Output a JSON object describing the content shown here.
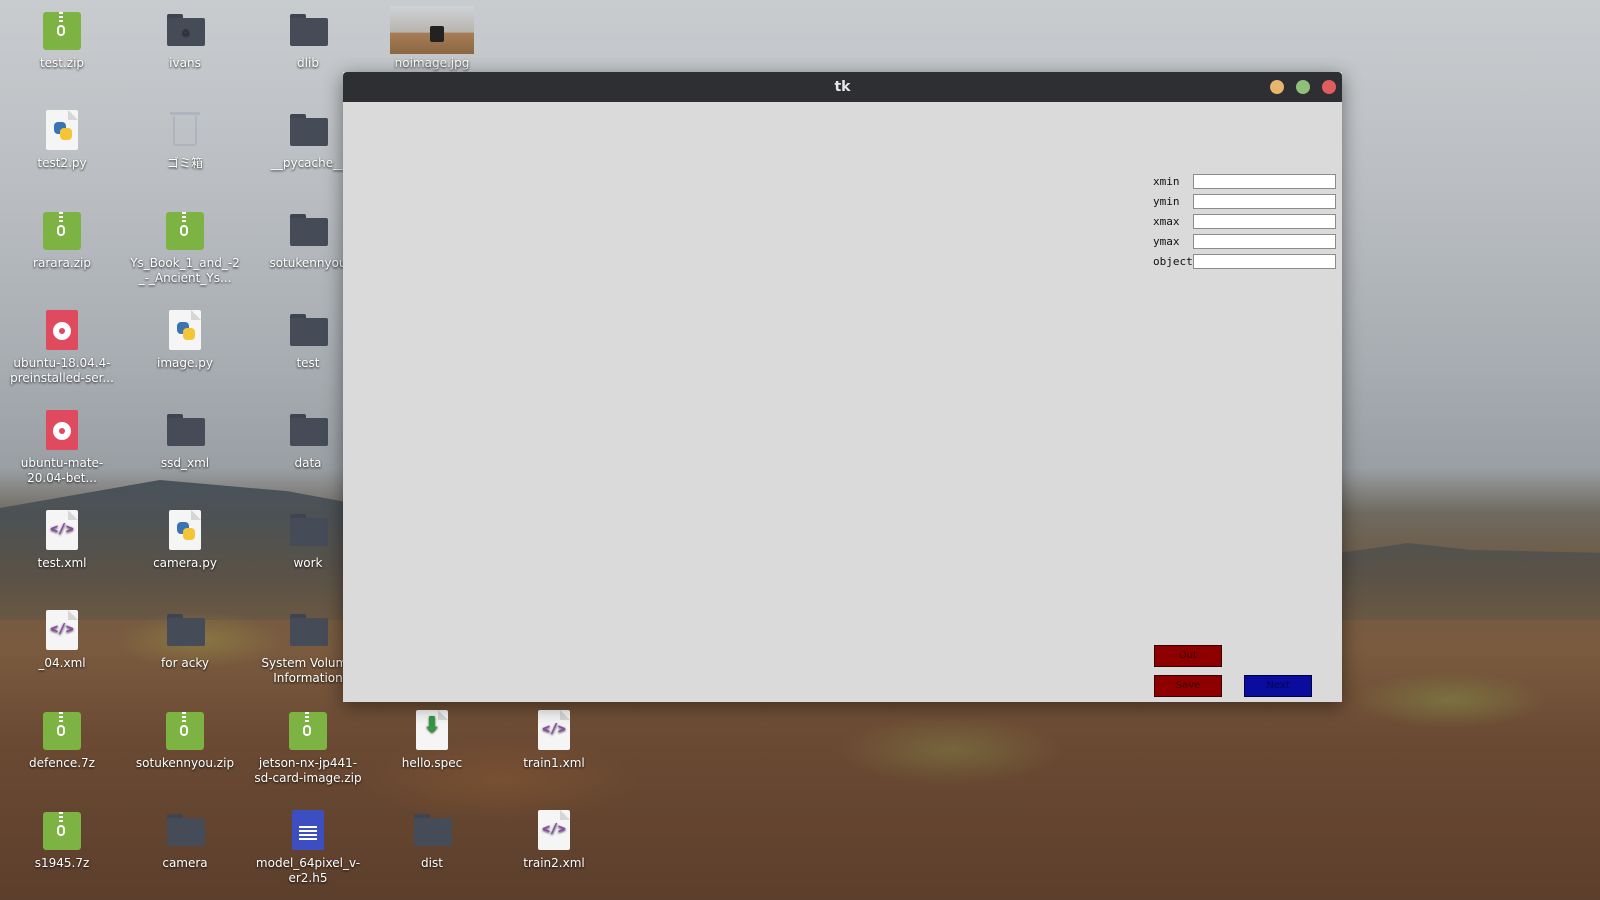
{
  "desktop": {
    "icons": [
      {
        "label": "test.zip",
        "type": "zip"
      },
      {
        "label": "ivans",
        "type": "folder-home"
      },
      {
        "label": "dlib",
        "type": "folder"
      },
      {
        "label": "noimage.jpg",
        "type": "image"
      },
      {
        "label": "test2.py",
        "type": "python"
      },
      {
        "label": "ゴミ箱",
        "type": "trash"
      },
      {
        "label": "__pycache__",
        "type": "folder"
      },
      {
        "label": "rarara.zip",
        "type": "zip"
      },
      {
        "label": "Ys_Book_1_and_-2_-_Ancient_Ys...",
        "type": "zip"
      },
      {
        "label": "sotukennyou",
        "type": "folder"
      },
      {
        "label": "ubuntu-18.04.4-preinstalled-ser...",
        "type": "disc"
      },
      {
        "label": "image.py",
        "type": "python"
      },
      {
        "label": "test",
        "type": "folder"
      },
      {
        "label": "ubuntu-mate-20.04-bet...",
        "type": "disc"
      },
      {
        "label": "ssd_xml",
        "type": "folder"
      },
      {
        "label": "data",
        "type": "folder"
      },
      {
        "label": "test.xml",
        "type": "xml"
      },
      {
        "label": "camera.py",
        "type": "python"
      },
      {
        "label": "work",
        "type": "folder"
      },
      {
        "label": "_04.xml",
        "type": "xml"
      },
      {
        "label": "for acky",
        "type": "folder"
      },
      {
        "label": "System Volume Information",
        "type": "folder"
      },
      {
        "label": "defence.7z",
        "type": "zip"
      },
      {
        "label": "sotukennyou.zip",
        "type": "zip"
      },
      {
        "label": "jetson-nx-jp441-sd-card-image.zip",
        "type": "zip"
      },
      {
        "label": "hello.spec",
        "type": "spec"
      },
      {
        "label": "train1.xml",
        "type": "xml"
      },
      {
        "label": "s1945.7z",
        "type": "zip"
      },
      {
        "label": "camera",
        "type": "folder"
      },
      {
        "label": "model_64pixel_v-er2.h5",
        "type": "h5"
      },
      {
        "label": "dist",
        "type": "folder"
      },
      {
        "label": "train2.xml",
        "type": "xml"
      }
    ]
  },
  "window": {
    "title": "tk",
    "fields": [
      {
        "label": "xmin",
        "value": ""
      },
      {
        "label": "ymin",
        "value": ""
      },
      {
        "label": "xmax",
        "value": ""
      },
      {
        "label": "ymax",
        "value": ""
      },
      {
        "label": "object",
        "value": ""
      }
    ],
    "buttons": {
      "out": "Out",
      "save": "Save",
      "next": "Next"
    },
    "colors": {
      "red_button": "#8e0000",
      "blue_button": "#0a0c9e",
      "titlebar": "#2d2f33"
    }
  }
}
